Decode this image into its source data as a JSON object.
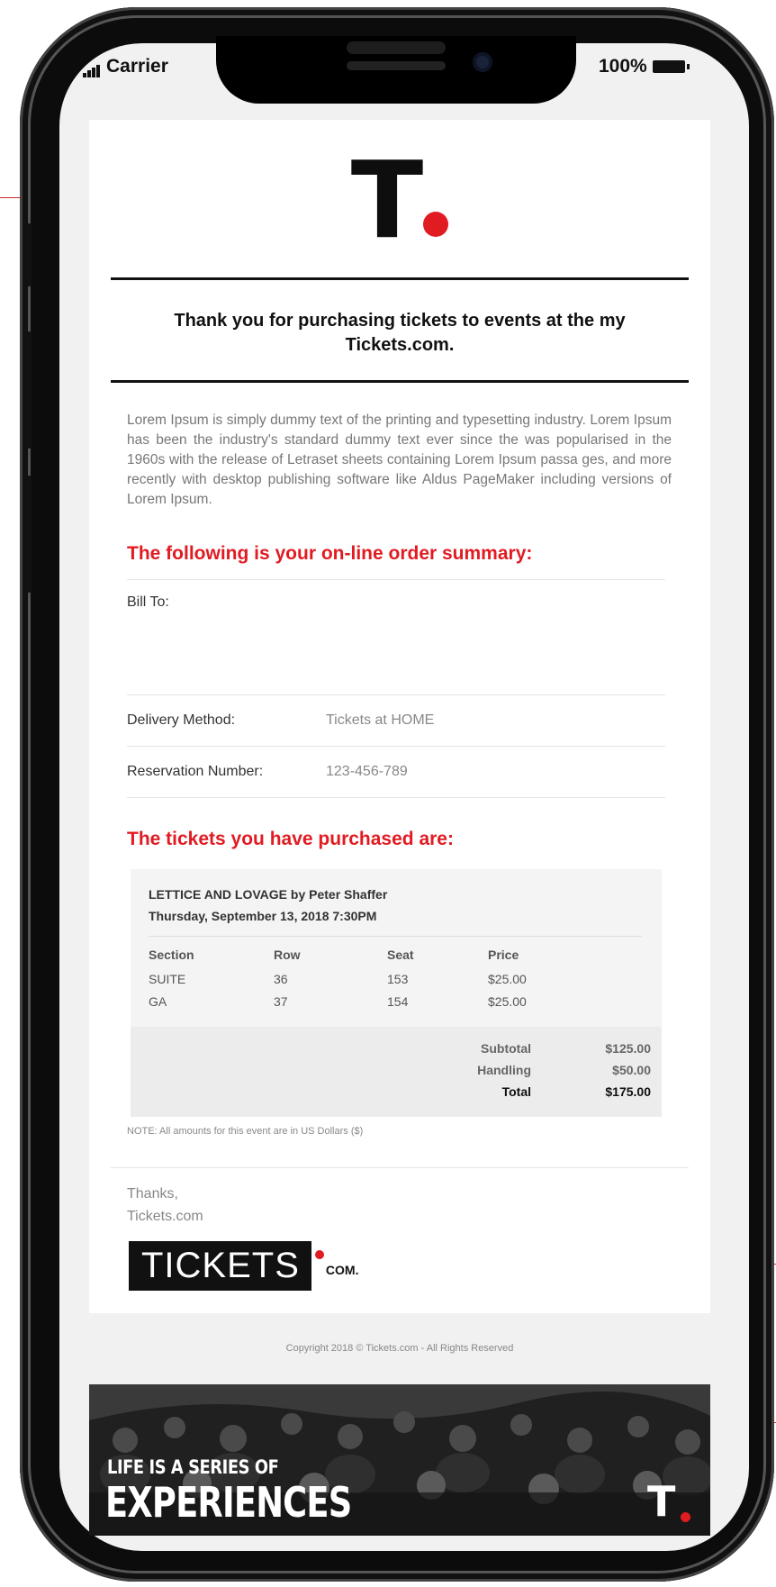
{
  "status_bar": {
    "carrier": "Carrier",
    "battery": "100%"
  },
  "email": {
    "logo_letter": "T",
    "heading": "Thank you for purchasing tickets to events at the my Tickets.com.",
    "intro": "Lorem Ipsum is simply dummy text of the printing and typesetting industry. Lorem Ipsum has been the industry's standard dummy text ever since the was popularised in the 1960s with the release of Letraset sheets containing Lorem Ipsum passa ges, and more recently with desktop publishing software like Aldus PageMaker including versions of Lorem Ipsum.",
    "order_summary_title": "The following is your on-line order summary:",
    "bill_to_label": "Bill To:",
    "delivery_label": "Delivery Method:",
    "delivery_value": "Tickets at HOME",
    "reservation_label": "Reservation Number:",
    "reservation_value": "123-456-789",
    "tickets_title": "The tickets you have purchased are:",
    "event_name": "LETTICE AND LOVAGE by Peter Shaffer",
    "event_date": "Thursday, September 13, 2018 7:30PM",
    "table_headers": {
      "section": "Section",
      "row": "Row",
      "seat": "Seat",
      "price": "Price"
    },
    "tickets": [
      {
        "section": "SUITE",
        "row": "36",
        "seat": "153",
        "price": "$25.00"
      },
      {
        "section": "GA",
        "row": "37",
        "seat": "154",
        "price": "$25.00"
      }
    ],
    "totals": {
      "subtotal_label": "Subtotal",
      "subtotal": "$125.00",
      "handling_label": "Handling",
      "handling": "$50.00",
      "total_label": "Total",
      "total": "$175.00"
    },
    "note": "NOTE: All amounts for this event are in US Dollars ($)",
    "sign_off_1": "Thanks,",
    "sign_off_2": "Tickets.com",
    "brand_word": "TICKETS",
    "brand_suffix": "COM."
  },
  "copyright": "Copyright 2018 © Tickets.com - All Rights Reserved",
  "banner": {
    "tagline_small": "LIFE IS A SERIES OF",
    "tagline_big": "EXPERIENCES",
    "logo_letter": "T"
  },
  "colors": {
    "accent_red": "#e11b22",
    "text_dark": "#111111",
    "text_grey": "#777777"
  }
}
